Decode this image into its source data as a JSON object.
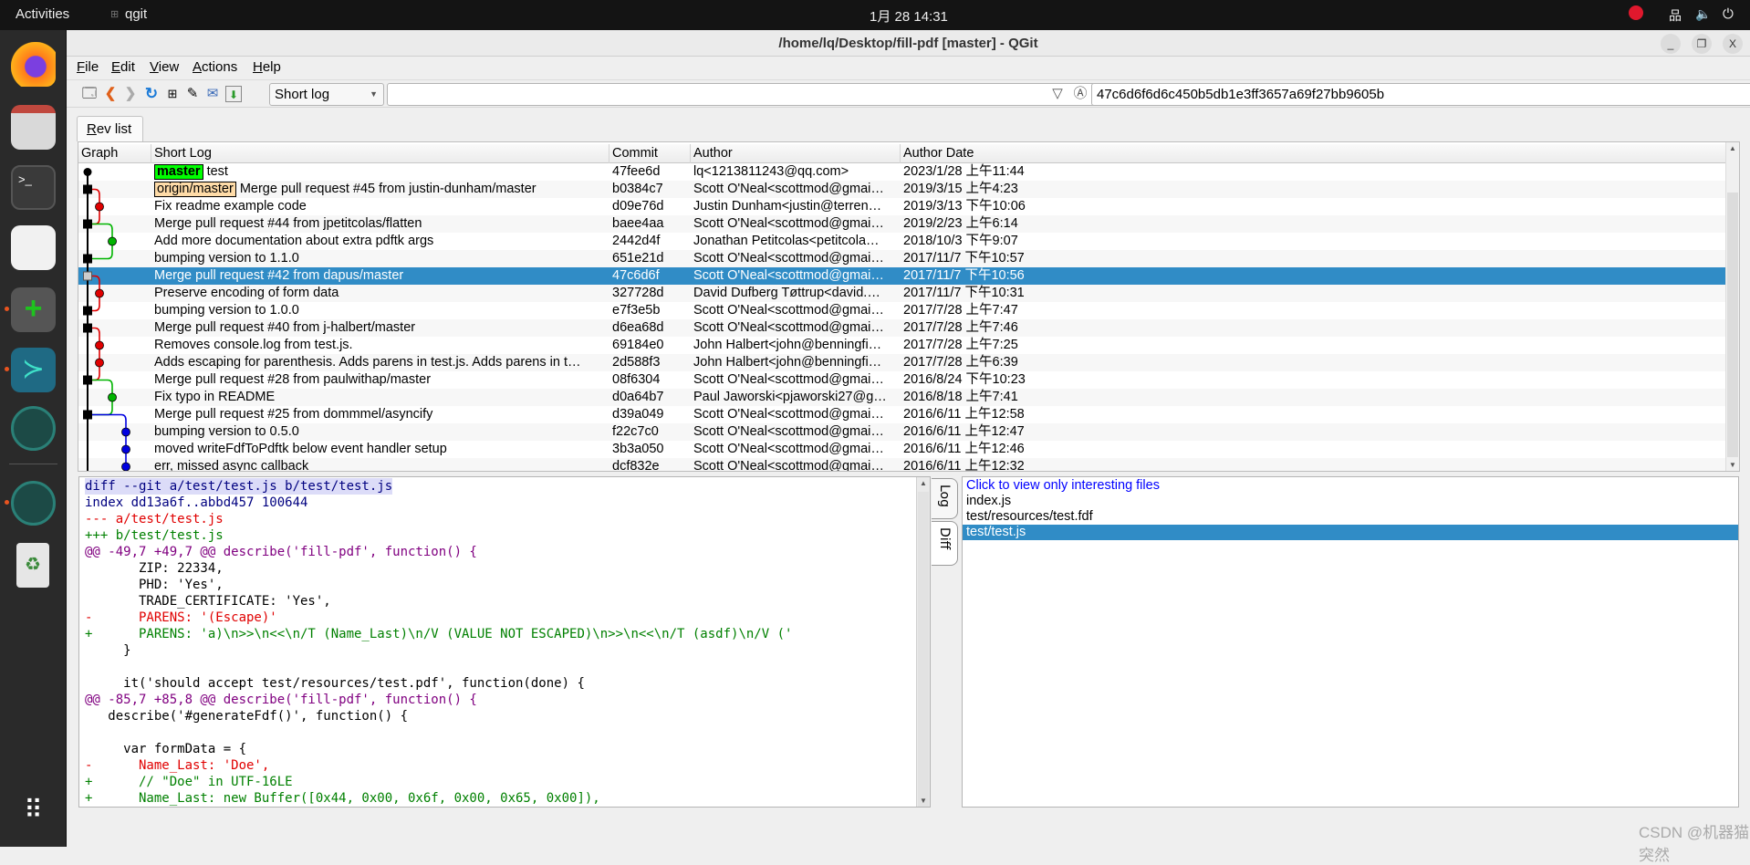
{
  "topbar": {
    "activities": "Activities",
    "app_name": "qgit",
    "clock": "1月 28  14:31",
    "icons": [
      "do-not-disturb-icon",
      "network-icon",
      "volume-icon",
      "power-icon"
    ]
  },
  "dock": {
    "apps": [
      "firefox",
      "files",
      "terminal",
      "git-gui",
      "qgit",
      "vscode",
      "gitkraken",
      "gitkraken",
      "trash",
      "show-apps"
    ]
  },
  "window": {
    "title": "/home/lq/Desktop/fill-pdf [master] - QGit",
    "minimize": "_",
    "maximize": "❐",
    "close": "X"
  },
  "menu": [
    {
      "key": "F",
      "rest": "ile"
    },
    {
      "key": "E",
      "rest": "dit"
    },
    {
      "key": "V",
      "rest": "iew"
    },
    {
      "key": "A",
      "rest": "ctions"
    },
    {
      "key": "H",
      "rest": "elp"
    }
  ],
  "toolbar": {
    "log_mode": "Short log",
    "filter_value": "",
    "sha_value": "47c6d6f6d6c450b5db1e3ff3657a69f27bb9605b"
  },
  "tabs": {
    "rev_list_key": "R",
    "rev_list_rest": "ev list"
  },
  "columns": [
    "Graph",
    "Short Log",
    "Commit",
    "Author",
    "Author Date"
  ],
  "colors": {
    "selection": "#308cc6",
    "lane_red": "#e00000",
    "lane_green": "#00b400",
    "lane_blue": "#0000e0",
    "ref_master": "#00ff00",
    "ref_origin": "#ffdca8"
  },
  "rows": [
    {
      "refs": [
        {
          "name": "master",
          "kind": "local"
        }
      ],
      "log": "test",
      "commit": "47fee6d",
      "author": "lq<1213811243@qq.com>",
      "date": "2023/1/28 上午11:44"
    },
    {
      "refs": [
        {
          "name": "origin/master",
          "kind": "remote"
        }
      ],
      "log": "Merge pull request #45 from justin-dunham/master",
      "commit": "b0384c7",
      "author": "Scott O'Neal<scottmod@gmai…",
      "date": "2019/3/15 上午4:23"
    },
    {
      "log": "Fix readme example code",
      "commit": "d09e76d",
      "author": "Justin Dunham<justin@terren…",
      "date": "2019/3/13 下午10:06"
    },
    {
      "log": "Merge pull request #44 from jpetitcolas/flatten",
      "commit": "baee4aa",
      "author": "Scott O'Neal<scottmod@gmai…",
      "date": "2019/2/23 上午6:14"
    },
    {
      "log": "Add more documentation about extra pdftk args",
      "commit": "2442d4f",
      "author": "Jonathan Petitcolas<petitcola…",
      "date": "2018/10/3 下午9:07"
    },
    {
      "log": "bumping version to 1.1.0",
      "commit": "651e21d",
      "author": "Scott O'Neal<scottmod@gmai…",
      "date": "2017/11/7 下午10:57"
    },
    {
      "log": "Merge pull request #42 from dapus/master",
      "commit": "47c6d6f",
      "author": "Scott O'Neal<scottmod@gmai…",
      "date": "2017/11/7 下午10:56",
      "selected": true
    },
    {
      "log": "Preserve encoding of form data",
      "commit": "327728d",
      "author": "David Dufberg Tøttrup<david.…",
      "date": "2017/11/7 下午10:31"
    },
    {
      "log": "bumping version to 1.0.0",
      "commit": "e7f3e5b",
      "author": "Scott O'Neal<scottmod@gmai…",
      "date": "2017/7/28 上午7:47"
    },
    {
      "log": "Merge pull request #40 from j-halbert/master",
      "commit": "d6ea68d",
      "author": "Scott O'Neal<scottmod@gmai…",
      "date": "2017/7/28 上午7:46"
    },
    {
      "log": "Removes console.log from test.js.",
      "commit": "69184e0",
      "author": "John Halbert<john@benningfi…",
      "date": "2017/7/28 上午7:25"
    },
    {
      "log": "Adds escaping for parenthesis. Adds parens in test.js. Adds parens in t…",
      "commit": "2d588f3",
      "author": "John Halbert<john@benningfi…",
      "date": "2017/7/28 上午6:39"
    },
    {
      "log": "Merge pull request #28 from paulwithap/master",
      "commit": "08f6304",
      "author": "Scott O'Neal<scottmod@gmai…",
      "date": "2016/8/24 下午10:23"
    },
    {
      "log": "Fix typo in README",
      "commit": "d0a64b7",
      "author": "Paul Jaworski<pjaworski27@g…",
      "date": "2016/8/18 上午7:41"
    },
    {
      "log": "Merge pull request #25 from dommmel/asyncify",
      "commit": "d39a049",
      "author": "Scott O'Neal<scottmod@gmai…",
      "date": "2016/6/11 上午12:58"
    },
    {
      "log": "bumping version to 0.5.0",
      "commit": "f22c7c0",
      "author": "Scott O'Neal<scottmod@gmai…",
      "date": "2016/6/11 上午12:47"
    },
    {
      "log": "moved writeFdfToPdftk below event handler setup",
      "commit": "3b3a050",
      "author": "Scott O'Neal<scottmod@gmai…",
      "date": "2016/6/11 上午12:46"
    },
    {
      "log": "err, missed async callback",
      "commit": "dcf832e",
      "author": "Scott O'Neal<scottmod@gmai…",
      "date": "2016/6/11 上午12:32"
    }
  ],
  "graph": {
    "main_nodes": [
      {
        "row": 0,
        "type": "dot"
      },
      {
        "row": 1,
        "type": "merge"
      },
      {
        "row": 3,
        "type": "merge"
      },
      {
        "row": 5,
        "type": "merge"
      },
      {
        "row": 6,
        "type": "merge-selected"
      },
      {
        "row": 8,
        "type": "merge"
      },
      {
        "row": 9,
        "type": "merge"
      },
      {
        "row": 12,
        "type": "merge"
      },
      {
        "row": 14,
        "type": "merge"
      }
    ],
    "branches": [
      {
        "lane": 1,
        "color": "red",
        "from": 1,
        "to": 3,
        "dots": [
          2
        ]
      },
      {
        "lane": 2,
        "color": "green",
        "from": 3,
        "to": 5,
        "dots": [
          4
        ]
      },
      {
        "lane": 1,
        "color": "red",
        "from": 6,
        "to": 8,
        "dots": [
          7
        ]
      },
      {
        "lane": 1,
        "color": "red",
        "from": 9,
        "to": 12,
        "dots": [
          10,
          11
        ]
      },
      {
        "lane": 2,
        "color": "green",
        "from": 12,
        "to": 14,
        "dots": [
          13
        ]
      },
      {
        "lane": 3,
        "color": "blue",
        "from": 14,
        "to": null,
        "dots": [
          15,
          16,
          17
        ]
      }
    ]
  },
  "diff": [
    {
      "t": "header",
      "s": "diff --git a/test/test.js b/test/test.js"
    },
    {
      "t": "meta",
      "s": "index dd13a6f..abbd457 100644"
    },
    {
      "t": "del",
      "s": "--- a/test/test.js"
    },
    {
      "t": "add",
      "s": "+++ b/test/test.js"
    },
    {
      "t": "hunk",
      "s": "@@ -49,7 +49,7 @@ describe('fill-pdf', function() {"
    },
    {
      "t": "ctx",
      "s": "       ZIP: 22334,"
    },
    {
      "t": "ctx",
      "s": "       PHD: 'Yes',"
    },
    {
      "t": "ctx",
      "s": "       TRADE_CERTIFICATE: 'Yes',"
    },
    {
      "t": "del",
      "s": "-      PARENS: '(Escape)'"
    },
    {
      "t": "add",
      "s": "+      PARENS: 'a)\\n>>\\n<<\\n/T (Name_Last)\\n/V (VALUE NOT ESCAPED)\\n>>\\n<<\\n/T (asdf)\\n/V ('"
    },
    {
      "t": "ctx",
      "s": "     }"
    },
    {
      "t": "ctx",
      "s": " "
    },
    {
      "t": "ctx",
      "s": "     it('should accept test/resources/test.pdf', function(done) {"
    },
    {
      "t": "hunk",
      "s": "@@ -85,7 +85,8 @@ describe('fill-pdf', function() {"
    },
    {
      "t": "ctx",
      "s": "   describe('#generateFdf()', function() {"
    },
    {
      "t": "ctx",
      "s": " "
    },
    {
      "t": "ctx",
      "s": "     var formData = {"
    },
    {
      "t": "del",
      "s": "-      Name_Last: 'Doe',"
    },
    {
      "t": "add",
      "s": "+      // \"Doe\" in UTF-16LE"
    },
    {
      "t": "add",
      "s": "+      Name_Last: new Buffer([0x44, 0x00, 0x6f, 0x00, 0x65, 0x00]),"
    }
  ],
  "side_tabs": {
    "log": "Log",
    "diff": "Diff"
  },
  "files": {
    "interesting_link": "Click to view only interesting files",
    "items": [
      {
        "name": "index.js"
      },
      {
        "name": "test/resources/test.fdf"
      },
      {
        "name": "test/test.js",
        "selected": true
      }
    ]
  },
  "watermark": "CSDN @机器猫突然"
}
